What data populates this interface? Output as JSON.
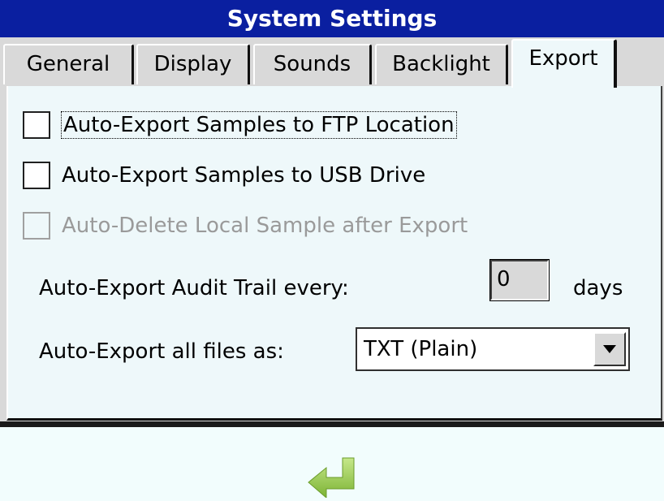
{
  "window": {
    "title": "System Settings"
  },
  "tabs": [
    {
      "label": "General",
      "active": false
    },
    {
      "label": "Display",
      "active": false
    },
    {
      "label": "Sounds",
      "active": false
    },
    {
      "label": "Backlight",
      "active": false
    },
    {
      "label": "Export",
      "active": true
    }
  ],
  "export": {
    "options": [
      {
        "label": "Auto-Export Samples to FTP Location",
        "checked": false,
        "enabled": true,
        "focused": true
      },
      {
        "label": "Auto-Export Samples to USB Drive",
        "checked": false,
        "enabled": true,
        "focused": false
      },
      {
        "label": "Auto-Delete Local Sample after Export",
        "checked": false,
        "enabled": false,
        "focused": false
      }
    ],
    "audit_trail": {
      "label": "Auto-Export Audit Trail every:",
      "value": "0",
      "unit": "days"
    },
    "file_format": {
      "label": "Auto-Export all files as:",
      "selected": "TXT (Plain)"
    }
  },
  "footer": {
    "back_icon": "return-arrow-icon",
    "back_icon_color": "#8cc63f"
  },
  "colors": {
    "titlebar": "#0a1fa0",
    "panel": "#eef8fa",
    "chrome": "#d9d9d9",
    "disabled_text": "#9a9a9a"
  }
}
